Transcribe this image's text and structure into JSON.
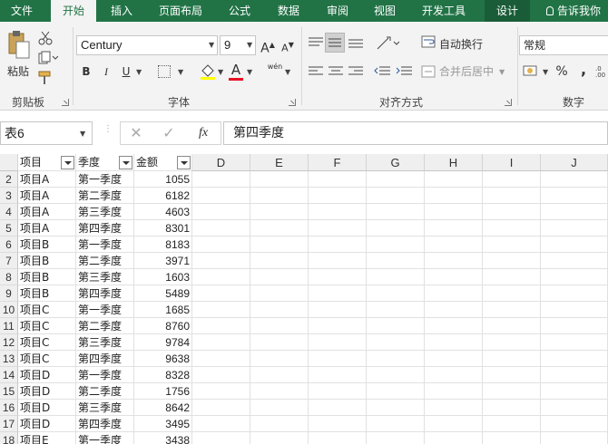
{
  "ribbon_tabs": [
    "文件",
    "开始",
    "插入",
    "页面布局",
    "公式",
    "数据",
    "审阅",
    "视图",
    "开发工具",
    "设计"
  ],
  "tell_me": "告诉我你",
  "clipboard": {
    "paste": "粘贴",
    "label": "剪贴板"
  },
  "font": {
    "name": "Century",
    "size": "9",
    "label": "字体",
    "bold": "B",
    "italic": "I",
    "underline": "U",
    "grow": "A",
    "shrink": "A",
    "font_color_glyph": "A",
    "phonetic_glyph": "wén"
  },
  "alignment": {
    "wrap": "自动换行",
    "merge": "合并后居中",
    "label": "对齐方式"
  },
  "number": {
    "format": "常规",
    "label": "数字",
    "percent": "%",
    "comma": ","
  },
  "name_box": "表6",
  "formula": "第四季度",
  "fx": "fx",
  "columns": [
    "D",
    "E",
    "F",
    "G",
    "H",
    "I",
    "J"
  ],
  "table_headers": [
    "项目",
    "季度",
    "金额"
  ],
  "rows": [
    {
      "n": "2",
      "item": "项目A",
      "q": "第一季度",
      "amt": "1055"
    },
    {
      "n": "3",
      "item": "项目A",
      "q": "第二季度",
      "amt": "6182"
    },
    {
      "n": "4",
      "item": "项目A",
      "q": "第三季度",
      "amt": "4603"
    },
    {
      "n": "5",
      "item": "项目A",
      "q": "第四季度",
      "amt": "8301"
    },
    {
      "n": "6",
      "item": "项目B",
      "q": "第一季度",
      "amt": "8183"
    },
    {
      "n": "7",
      "item": "项目B",
      "q": "第二季度",
      "amt": "3971"
    },
    {
      "n": "8",
      "item": "项目B",
      "q": "第三季度",
      "amt": "1603"
    },
    {
      "n": "9",
      "item": "项目B",
      "q": "第四季度",
      "amt": "5489"
    },
    {
      "n": "10",
      "item": "项目C",
      "q": "第一季度",
      "amt": "1685"
    },
    {
      "n": "11",
      "item": "项目C",
      "q": "第二季度",
      "amt": "8760"
    },
    {
      "n": "12",
      "item": "项目C",
      "q": "第三季度",
      "amt": "9784"
    },
    {
      "n": "13",
      "item": "项目C",
      "q": "第四季度",
      "amt": "9638"
    },
    {
      "n": "14",
      "item": "项目D",
      "q": "第一季度",
      "amt": "8328"
    },
    {
      "n": "15",
      "item": "项目D",
      "q": "第二季度",
      "amt": "1756"
    },
    {
      "n": "16",
      "item": "项目D",
      "q": "第三季度",
      "amt": "8642"
    },
    {
      "n": "17",
      "item": "项目D",
      "q": "第四季度",
      "amt": "3495"
    },
    {
      "n": "18",
      "item": "项目E",
      "q": "第一季度",
      "amt": "3438"
    }
  ],
  "colors": {
    "brand": "#217346",
    "design_tab": "#1a5c38",
    "font_color_bar": "#e81123"
  }
}
